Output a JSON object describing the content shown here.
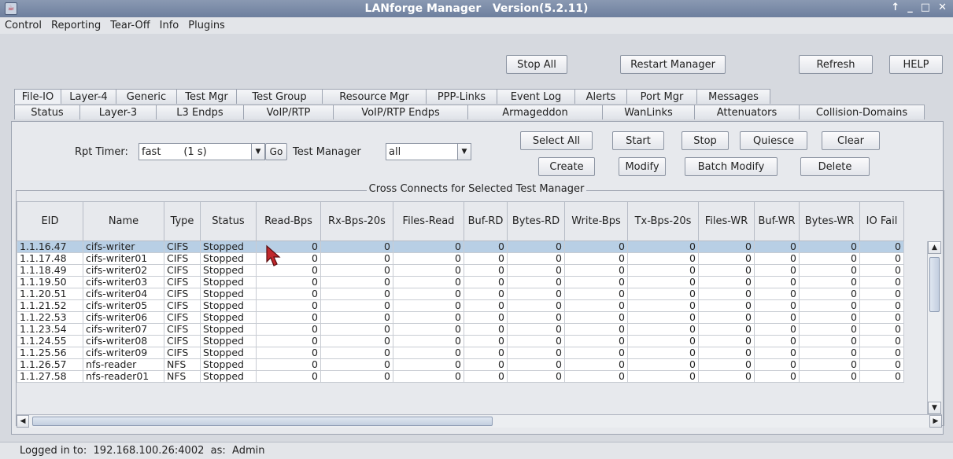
{
  "window": {
    "title": "LANforge Manager   Version(5.2.11)",
    "controls": [
      "↑",
      "_",
      "□",
      "✕"
    ]
  },
  "menu": [
    "Control",
    "Reporting",
    "Tear-Off",
    "Info",
    "Plugins"
  ],
  "toolbar": {
    "stop_all": "Stop All",
    "restart_manager": "Restart Manager",
    "refresh": "Refresh",
    "help": "HELP"
  },
  "tabs_row1": [
    "File-IO",
    "Layer-4",
    "Generic",
    "Test Mgr",
    "Test Group",
    "Resource Mgr",
    "PPP-Links",
    "Event Log",
    "Alerts",
    "Port Mgr",
    "Messages"
  ],
  "tabs_row2": [
    "Status",
    "Layer-3",
    "L3 Endps",
    "VoIP/RTP",
    "VoIP/RTP Endps",
    "Armageddon",
    "WanLinks",
    "Attenuators",
    "Collision-Domains"
  ],
  "controls": {
    "rpt_timer_label": "Rpt Timer:",
    "rpt_timer_value": "fast       (1 s)",
    "go": "Go",
    "test_manager_label": "Test Manager",
    "test_manager_value": "all",
    "select_all": "Select All",
    "start": "Start",
    "stop": "Stop",
    "quiesce": "Quiesce",
    "clear": "Clear",
    "create": "Create",
    "modify": "Modify",
    "batch_modify": "Batch Modify",
    "delete": "Delete"
  },
  "table": {
    "title": "Cross Connects for Selected Test Manager",
    "columns": [
      "EID",
      "Name",
      "Type",
      "Status",
      "Read-Bps",
      "Rx-Bps-20s",
      "Files-Read",
      "Buf-RD",
      "Bytes-RD",
      "Write-Bps",
      "Tx-Bps-20s",
      "Files-WR",
      "Buf-WR",
      "Bytes-WR",
      "IO Fail"
    ],
    "rows": [
      [
        "1.1.16.47",
        "cifs-writer",
        "CIFS",
        "Stopped",
        "0",
        "0",
        "0",
        "0",
        "0",
        "0",
        "0",
        "0",
        "0",
        "0",
        "0"
      ],
      [
        "1.1.17.48",
        "cifs-writer01",
        "CIFS",
        "Stopped",
        "0",
        "0",
        "0",
        "0",
        "0",
        "0",
        "0",
        "0",
        "0",
        "0",
        "0"
      ],
      [
        "1.1.18.49",
        "cifs-writer02",
        "CIFS",
        "Stopped",
        "0",
        "0",
        "0",
        "0",
        "0",
        "0",
        "0",
        "0",
        "0",
        "0",
        "0"
      ],
      [
        "1.1.19.50",
        "cifs-writer03",
        "CIFS",
        "Stopped",
        "0",
        "0",
        "0",
        "0",
        "0",
        "0",
        "0",
        "0",
        "0",
        "0",
        "0"
      ],
      [
        "1.1.20.51",
        "cifs-writer04",
        "CIFS",
        "Stopped",
        "0",
        "0",
        "0",
        "0",
        "0",
        "0",
        "0",
        "0",
        "0",
        "0",
        "0"
      ],
      [
        "1.1.21.52",
        "cifs-writer05",
        "CIFS",
        "Stopped",
        "0",
        "0",
        "0",
        "0",
        "0",
        "0",
        "0",
        "0",
        "0",
        "0",
        "0"
      ],
      [
        "1.1.22.53",
        "cifs-writer06",
        "CIFS",
        "Stopped",
        "0",
        "0",
        "0",
        "0",
        "0",
        "0",
        "0",
        "0",
        "0",
        "0",
        "0"
      ],
      [
        "1.1.23.54",
        "cifs-writer07",
        "CIFS",
        "Stopped",
        "0",
        "0",
        "0",
        "0",
        "0",
        "0",
        "0",
        "0",
        "0",
        "0",
        "0"
      ],
      [
        "1.1.24.55",
        "cifs-writer08",
        "CIFS",
        "Stopped",
        "0",
        "0",
        "0",
        "0",
        "0",
        "0",
        "0",
        "0",
        "0",
        "0",
        "0"
      ],
      [
        "1.1.25.56",
        "cifs-writer09",
        "CIFS",
        "Stopped",
        "0",
        "0",
        "0",
        "0",
        "0",
        "0",
        "0",
        "0",
        "0",
        "0",
        "0"
      ],
      [
        "1.1.26.57",
        "nfs-reader",
        "NFS",
        "Stopped",
        "0",
        "0",
        "0",
        "0",
        "0",
        "0",
        "0",
        "0",
        "0",
        "0",
        "0"
      ],
      [
        "1.1.27.58",
        "nfs-reader01",
        "NFS",
        "Stopped",
        "0",
        "0",
        "0",
        "0",
        "0",
        "0",
        "0",
        "0",
        "0",
        "0",
        "0"
      ]
    ]
  },
  "status_bar": "Logged in to:  192.168.100.26:4002  as:  Admin",
  "colors": {
    "title_bar": "#7a8aa8",
    "selected_row": "#b8cfe5",
    "cursor": "#c0282c"
  }
}
